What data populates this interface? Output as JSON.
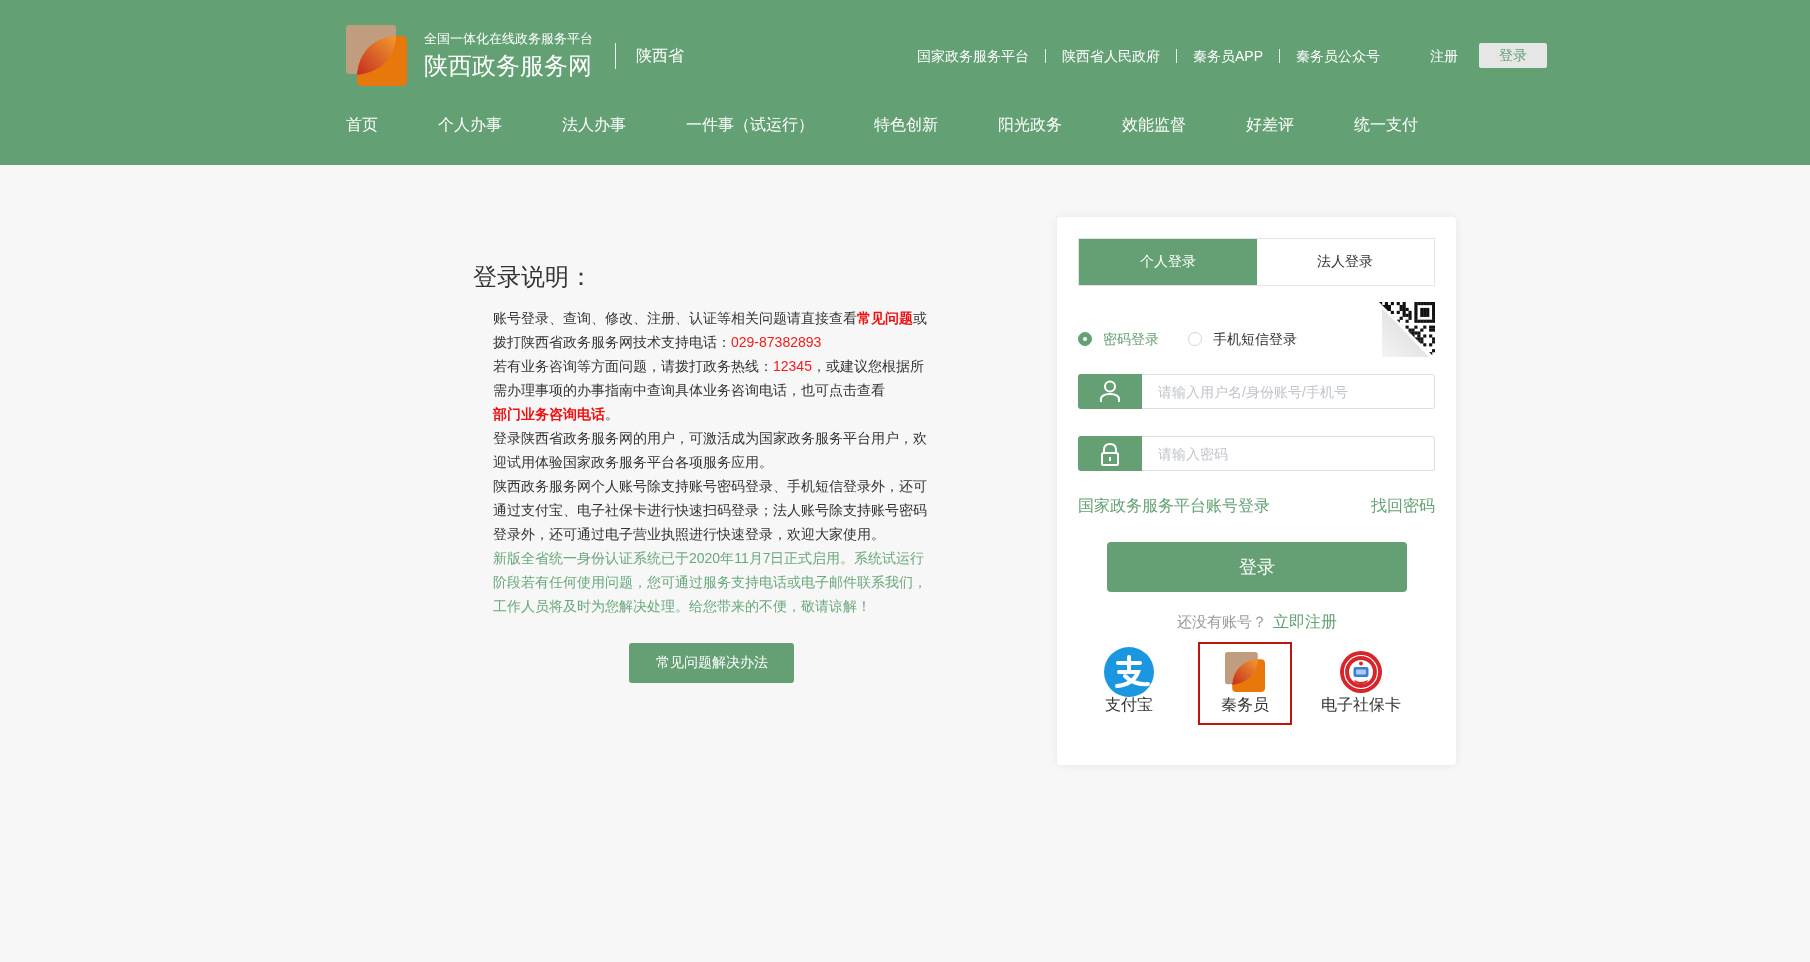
{
  "header": {
    "logo": {
      "subtitle": "全国一体化在线政务服务平台",
      "title": "陕西政务服务网"
    },
    "region": "陕西省",
    "top_links": [
      "国家政务服务平台",
      "陕西省人民政府",
      "秦务员APP",
      "秦务员公众号"
    ],
    "register": "注册",
    "login": "登录"
  },
  "nav": [
    "首页",
    "个人办事",
    "法人办事",
    "一件事（试运行）",
    "特色创新",
    "阳光政务",
    "效能监督",
    "好差评",
    "统一支付"
  ],
  "intro": {
    "title": "登录说明：",
    "paragraphs": [
      {
        "kind": "info",
        "parts": [
          {
            "kind": "text",
            "text": "账号登录、查询、修改、注册、认证等相关问题请直接查看"
          },
          {
            "kind": "link",
            "text": "常见问题"
          },
          {
            "kind": "text",
            "text": "或拨打陕西省政务服务网技术支持电话："
          },
          {
            "kind": "number",
            "text": "029-87382893"
          }
        ]
      },
      {
        "kind": "info",
        "parts": [
          {
            "kind": "text",
            "text": "若有业务咨询等方面问题，请拨打政务热线："
          },
          {
            "kind": "number",
            "text": "12345"
          },
          {
            "kind": "text",
            "text": "，或建议您根据所需办理事项的办事指南中查询具体业务咨询电话，也可点击查看"
          },
          {
            "kind": "link",
            "text": "部门业务咨询电话"
          },
          {
            "kind": "text",
            "text": "。"
          }
        ]
      },
      {
        "kind": "info",
        "parts": [
          {
            "kind": "text",
            "text": "登录陕西省政务服务网的用户，可激活成为国家政务服务平台用户，欢迎试用体验国家政务服务平台各项服务应用。"
          }
        ]
      },
      {
        "kind": "info",
        "parts": [
          {
            "kind": "text",
            "text": "陕西政务服务网个人账号除支持账号密码登录、手机短信登录外，还可通过支付宝、电子社保卡进行快速扫码登录；法人账号除支持账号密码登录外，还可通过电子营业执照进行快速登录，欢迎大家使用。"
          }
        ]
      },
      {
        "kind": "notice",
        "parts": [
          {
            "kind": "text",
            "text": "新版全省统一身份认证系统已于2020年11月7日正式启用。系统试运行阶段若有任何使用问题，您可通过服务支持电话或电子邮件联系我们，工作人员将及时为您解决处理。给您带来的不便，敬请谅解！"
          }
        ]
      }
    ],
    "button": "常见问题解决办法"
  },
  "login_card": {
    "tabs": [
      {
        "label": "个人登录",
        "selected": true
      },
      {
        "label": "法人登录",
        "selected": false
      }
    ],
    "modes": [
      {
        "label": "密码登录",
        "selected": true
      },
      {
        "label": "手机短信登录",
        "selected": false
      }
    ],
    "fields": [
      {
        "kind": "user",
        "placeholder": "请输入用户名/身份账号/手机号"
      },
      {
        "kind": "password",
        "placeholder": "请输入密码"
      }
    ],
    "links": [
      "国家政务服务平台账号登录",
      "找回密码"
    ],
    "submit": "登录",
    "signup": {
      "prompt": "还没有账号？",
      "link": "立即注册"
    },
    "third_party": [
      {
        "kind": "alipay",
        "label": "支付宝",
        "selected": false
      },
      {
        "kind": "qinwuyuan",
        "label": "秦务员",
        "selected": true
      },
      {
        "kind": "social_card",
        "label": "电子社保卡",
        "selected": false
      }
    ]
  }
}
